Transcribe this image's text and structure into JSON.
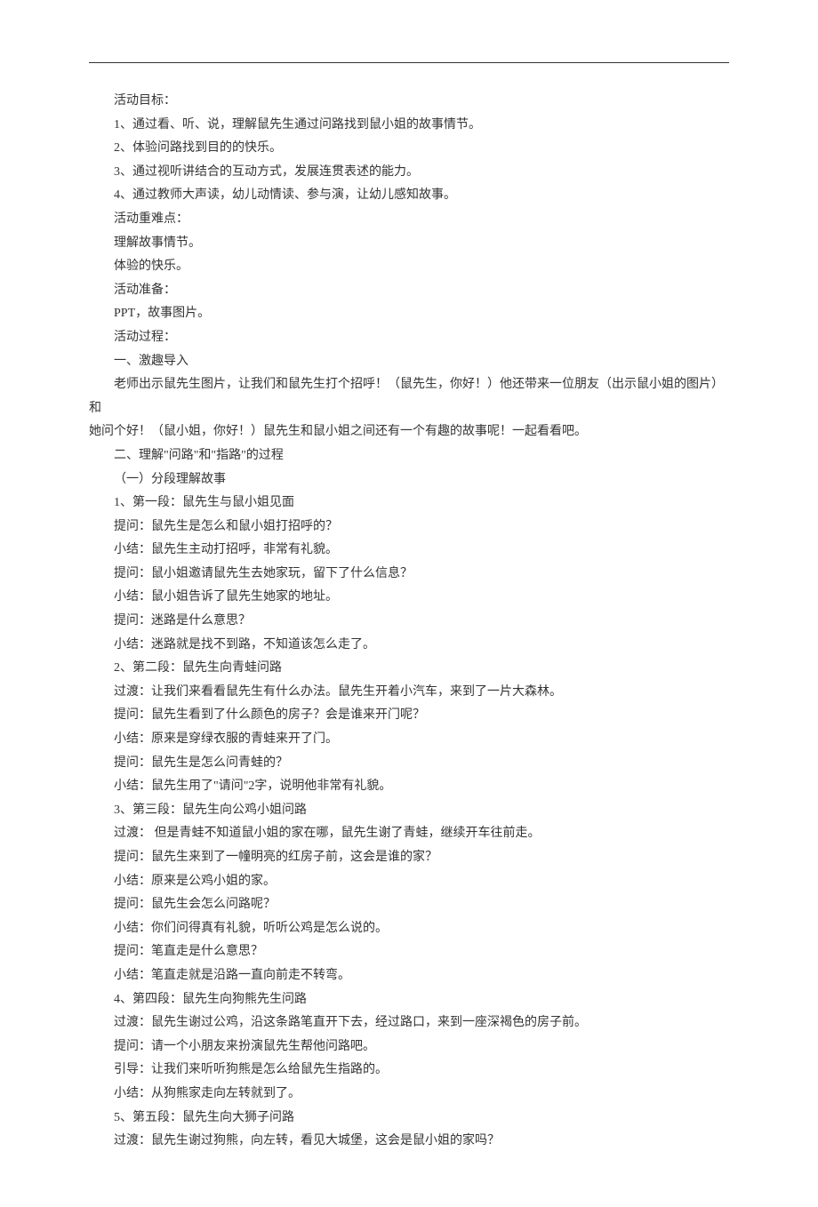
{
  "lines": [
    "活动目标：",
    "1、通过看、听、说，理解鼠先生通过问路找到鼠小姐的故事情节。",
    "2、体验问路找到目的的快乐。",
    "3、通过视听讲结合的互动方式，发展连贯表述的能力。",
    "4、通过教师大声读，幼儿动情读、参与演，让幼儿感知故事。",
    "活动重难点：",
    "理解故事情节。",
    "体验的快乐。",
    "活动准备：",
    "PPT，故事图片。",
    "活动过程：",
    "一、激趣导入",
    "老师出示鼠先生图片，让我们和鼠先生打个招呼！（鼠先生，你好！）他还带来一位朋友（出示鼠小姐的图片）和",
    "她问个好！（鼠小姐，你好！）鼠先生和鼠小姐之间还有一个有趣的故事呢！一起看看吧。",
    "二、理解\"问路\"和\"指路\"的过程",
    "（一）分段理解故事",
    "1、第一段：鼠先生与鼠小姐见面",
    "提问：鼠先生是怎么和鼠小姐打招呼的？",
    "小结：鼠先生主动打招呼，非常有礼貌。",
    "提问：鼠小姐邀请鼠先生去她家玩，留下了什么信息？",
    "小结：鼠小姐告诉了鼠先生她家的地址。",
    "提问：迷路是什么意思？",
    "小结：迷路就是找不到路，不知道该怎么走了。",
    "2、第二段：鼠先生向青蛙问路",
    "过渡：让我们来看看鼠先生有什么办法。鼠先生开着小汽车，来到了一片大森林。",
    "提问：鼠先生看到了什么颜色的房子？会是谁来开门呢？",
    "小结：原来是穿绿衣服的青蛙来开了门。",
    "提问：鼠先生是怎么问青蛙的？",
    "小结：鼠先生用了\"请问\"2字，说明他非常有礼貌。",
    "3、第三段：鼠先生向公鸡小姐问路",
    "过渡： 但是青蛙不知道鼠小姐的家在哪，鼠先生谢了青蛙，继续开车往前走。",
    "提问：鼠先生来到了一幢明亮的红房子前，这会是谁的家？",
    "小结：原来是公鸡小姐的家。",
    "提问：鼠先生会怎么问路呢？",
    "小结：你们问得真有礼貌，听听公鸡是怎么说的。",
    "提问：笔直走是什么意思？",
    "小结：笔直走就是沿路一直向前走不转弯。",
    "4、第四段：鼠先生向狗熊先生问路",
    "过渡：鼠先生谢过公鸡，沿这条路笔直开下去，经过路口，来到一座深褐色的房子前。",
    "提问：请一个小朋友来扮演鼠先生帮他问路吧。",
    "引导：让我们来听听狗熊是怎么给鼠先生指路的。",
    "小结：从狗熊家走向左转就到了。",
    "5、第五段：鼠先生向大狮子问路",
    "过渡：鼠先生谢过狗熊，向左转，看见大城堡，这会是鼠小姐的家吗？"
  ],
  "flushIndexes": [
    13
  ]
}
